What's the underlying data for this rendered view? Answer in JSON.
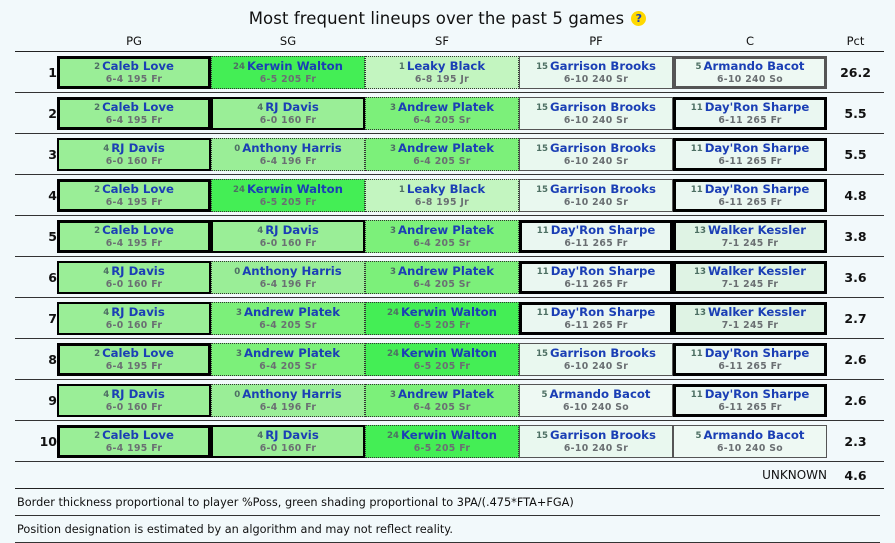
{
  "header": {
    "title": "Most frequent lineups over the past 5 games",
    "help_icon": "question-mark-icon",
    "columns": [
      "PG",
      "SG",
      "SF",
      "PF",
      "C",
      "Pct"
    ]
  },
  "players": {
    "caleb_love": {
      "number": "2",
      "name": "Caleb Love",
      "meta": "6-4 195 Fr",
      "fill": "#9aee97",
      "border_px": 3.6,
      "border_style": "solid",
      "border_color": "#000000"
    },
    "rj_davis": {
      "number": "4",
      "name": "RJ Davis",
      "meta": "6-0 160 Fr",
      "fill": "#9aee97",
      "border_px": 2.6,
      "border_style": "solid",
      "border_color": "#000000"
    },
    "kerwin_walton": {
      "number": "24",
      "name": "Kerwin Walton",
      "meta": "6-5 205 Fr",
      "fill": "#44ee55",
      "border_px": 1.3,
      "border_style": "dotted",
      "border_color": "#333333"
    },
    "leaky_black": {
      "number": "1",
      "name": "Leaky Black",
      "meta": "6-8 195 Jr",
      "fill": "#c3f5c0",
      "border_px": 1.3,
      "border_style": "dotted",
      "border_color": "#333333"
    },
    "andrew_platek": {
      "number": "3",
      "name": "Andrew Platek",
      "meta": "6-4 205 Sr",
      "fill": "#7cf07a",
      "border_px": 1.3,
      "border_style": "dotted",
      "border_color": "#333333"
    },
    "anthony_harris": {
      "number": "0",
      "name": "Anthony Harris",
      "meta": "6-4 196 Fr",
      "fill": "#9aee97",
      "border_px": 1.3,
      "border_style": "dotted",
      "border_color": "#333333"
    },
    "garrison_brooks": {
      "number": "15",
      "name": "Garrison Brooks",
      "meta": "6-10 240 Sr",
      "fill": "#e9f8ef",
      "border_px": 1.3,
      "border_style": "solid",
      "border_color": "#555555"
    },
    "armando_bacot": {
      "number": "5",
      "name": "Armando Bacot",
      "meta": "6-10 240 So",
      "fill": "#eef9f3",
      "border_px": 1.3,
      "border_style": "solid",
      "border_color": "#555555"
    },
    "dayron_sharpe": {
      "number": "11",
      "name": "Day'Ron Sharpe",
      "meta": "6-11 265 Fr",
      "fill": "#eaf7f1",
      "border_px": 3.6,
      "border_style": "solid",
      "border_color": "#000000"
    },
    "walker_kessler": {
      "number": "13",
      "name": "Walker Kessler",
      "meta": "7-1 245 Fr",
      "fill": "#dff3e4",
      "border_px": 3.2,
      "border_style": "solid",
      "border_color": "#000000"
    }
  },
  "rows": [
    {
      "rank": "1",
      "lineup": [
        "caleb_love",
        "kerwin_walton",
        "leaky_black",
        "garrison_brooks",
        "armando_bacot"
      ],
      "pct": "26.2",
      "bacot_thick": true
    },
    {
      "rank": "2",
      "lineup": [
        "caleb_love",
        "rj_davis",
        "andrew_platek",
        "garrison_brooks",
        "dayron_sharpe"
      ],
      "pct": "5.5"
    },
    {
      "rank": "3",
      "lineup": [
        "rj_davis",
        "anthony_harris",
        "andrew_platek",
        "garrison_brooks",
        "dayron_sharpe"
      ],
      "pct": "5.5"
    },
    {
      "rank": "4",
      "lineup": [
        "caleb_love",
        "kerwin_walton",
        "leaky_black",
        "garrison_brooks",
        "dayron_sharpe"
      ],
      "pct": "4.8"
    },
    {
      "rank": "5",
      "lineup": [
        "caleb_love",
        "rj_davis",
        "andrew_platek",
        "dayron_sharpe",
        "walker_kessler"
      ],
      "pct": "3.8"
    },
    {
      "rank": "6",
      "lineup": [
        "rj_davis",
        "anthony_harris",
        "andrew_platek",
        "dayron_sharpe",
        "walker_kessler"
      ],
      "pct": "3.6"
    },
    {
      "rank": "7",
      "lineup": [
        "rj_davis",
        "andrew_platek",
        "kerwin_walton",
        "dayron_sharpe",
        "walker_kessler"
      ],
      "pct": "2.7"
    },
    {
      "rank": "8",
      "lineup": [
        "caleb_love",
        "andrew_platek",
        "kerwin_walton",
        "garrison_brooks",
        "dayron_sharpe"
      ],
      "pct": "2.6"
    },
    {
      "rank": "9",
      "lineup": [
        "rj_davis",
        "anthony_harris",
        "andrew_platek",
        "armando_bacot",
        "dayron_sharpe"
      ],
      "pct": "2.6"
    },
    {
      "rank": "10",
      "lineup": [
        "caleb_love",
        "rj_davis",
        "kerwin_walton",
        "garrison_brooks",
        "armando_bacot"
      ],
      "pct": "2.3"
    }
  ],
  "unknown_row": {
    "label": "UNKNOWN",
    "pct": "4.6"
  },
  "notes": [
    "Border thickness proportional to player %Poss, green shading proportional to 3PA/(.475*FTA+FGA)",
    "Position designation is estimated by an algorithm and may not reflect reality."
  ]
}
